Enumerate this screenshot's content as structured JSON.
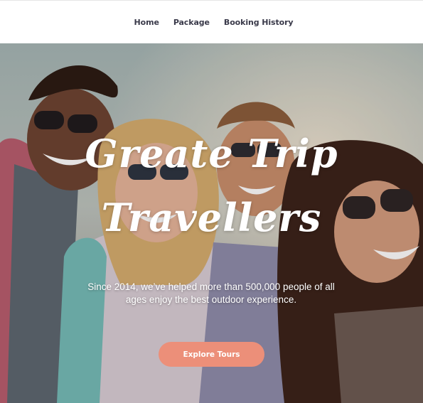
{
  "nav": {
    "items": [
      {
        "label": "Home"
      },
      {
        "label": "Package"
      },
      {
        "label": "Booking History"
      }
    ]
  },
  "hero": {
    "title_line1": "Greate Trip",
    "title_line2": "Travellers",
    "subtitle": "Since 2014, we’ve helped more than 500,000 people of all ages enjoy the best outdoor experience.",
    "cta_label": "Explore Tours"
  },
  "colors": {
    "cta": "#ec8f79",
    "nav_text": "#3a3a4a",
    "sky": "#a8b9b8"
  }
}
